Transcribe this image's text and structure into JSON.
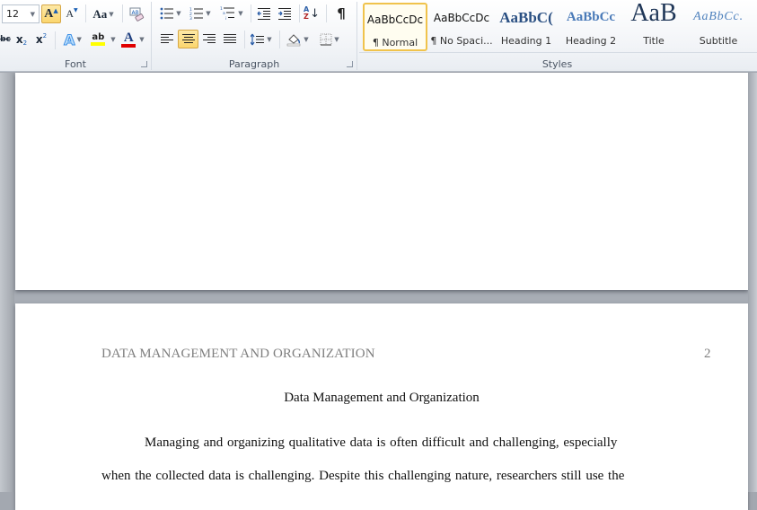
{
  "ribbon": {
    "font_group": {
      "label": "Font",
      "font_size": "12",
      "grow_font_icon": "A",
      "shrink_font_icon": "A",
      "change_case_label": "Aa",
      "strikethrough_glyph": "abc",
      "subscript_glyph": "x₂",
      "superscript_glyph": "x²",
      "text_effects_glyph": "A",
      "highlight_glyph": "ab",
      "font_color_glyph": "A",
      "highlight_color": "#ffff00",
      "font_color": "#e00000"
    },
    "paragraph_group": {
      "label": "Paragraph",
      "sort_glyph_top": "A",
      "sort_glyph_bottom": "Z",
      "pilcrow": "¶"
    },
    "styles_group": {
      "label": "Styles",
      "items": [
        {
          "sample": "AaBbCcDc",
          "name": "¶ Normal",
          "selected": true
        },
        {
          "sample": "AaBbCcDc",
          "name": "¶ No Spaci...",
          "selected": false
        },
        {
          "sample": "AaBbC(",
          "name": "Heading 1",
          "selected": false
        },
        {
          "sample": "AaBbCc",
          "name": "Heading 2",
          "selected": false
        },
        {
          "sample": "AaB",
          "name": "Title",
          "selected": false
        },
        {
          "sample": "AaBbCc.",
          "name": "Subtitle",
          "selected": false
        }
      ]
    }
  },
  "document": {
    "running_header": "DATA MANAGEMENT AND ORGANIZATION",
    "page_number": "2",
    "title": "Data Management and Organization",
    "paragraph_lines": [
      "Managing and organizing qualitative data is often difficult and challenging,  especially",
      "when the collected data is challenging.  Despite this challenging  nature, researchers  still use the"
    ]
  }
}
